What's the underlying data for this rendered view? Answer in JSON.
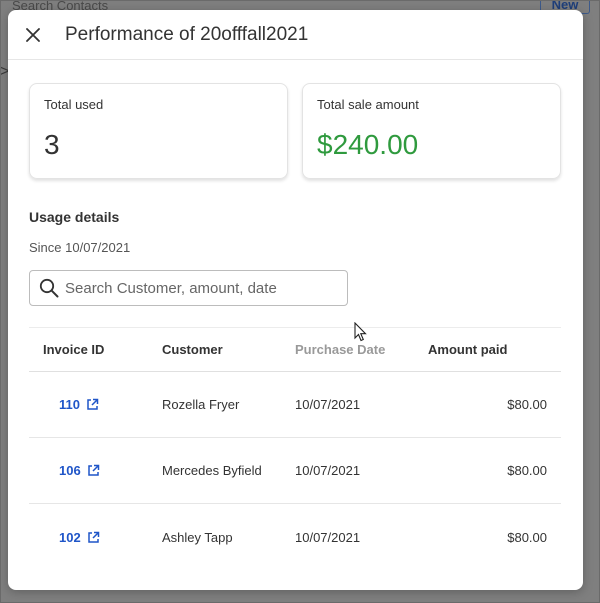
{
  "background": {
    "search_placeholder": "Search Contacts",
    "new_button": "New"
  },
  "modal": {
    "title": "Performance of 20offfall2021",
    "close_icon": "close-icon"
  },
  "stats": {
    "total_used_label": "Total used",
    "total_used_value": "3",
    "total_sale_label": "Total sale amount",
    "total_sale_value": "$240.00"
  },
  "usage": {
    "title": "Usage details",
    "since": "Since 10/07/2021",
    "search_placeholder": "Search Customer, amount, date"
  },
  "table": {
    "headers": [
      "Invoice ID",
      "Customer",
      "Purchase Date",
      "Amount paid"
    ],
    "rows": [
      {
        "invoice": "110",
        "customer": "Rozella Fryer",
        "date": "10/07/2021",
        "amount": "$80.00"
      },
      {
        "invoice": "106",
        "customer": "Mercedes Byfield",
        "date": "10/07/2021",
        "amount": "$80.00"
      },
      {
        "invoice": "102",
        "customer": "Ashley Tapp",
        "date": "10/07/2021",
        "amount": "$80.00"
      }
    ]
  },
  "colors": {
    "accent_link": "#1f55c8",
    "sale_green": "#2f9a3e"
  }
}
